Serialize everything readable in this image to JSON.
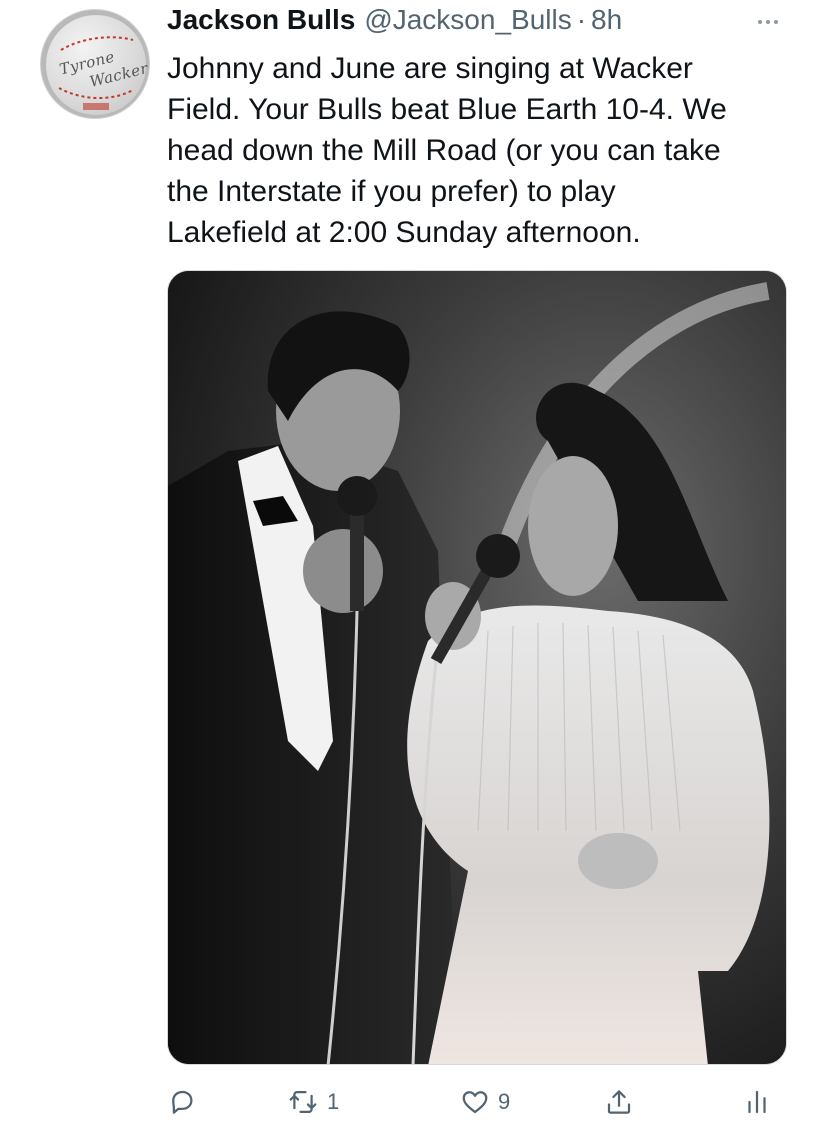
{
  "author": {
    "display_name": "Jackson Bulls",
    "handle": "@Jackson_Bulls",
    "separator": "·",
    "time": "8h",
    "avatar": {
      "line1": "Tyrone",
      "line2": "Wacker"
    }
  },
  "tweet": {
    "text": "Johnny and June are singing at Wacker\nField. Your Bulls beat Blue Earth 10-4. We\nhead down the Mill Road (or you can take\nthe Interstate if you prefer) to play\nLakefield at 2:00 Sunday afternoon."
  },
  "actions": {
    "reply_count": "",
    "retweet_count": "1",
    "like_count": "9",
    "icons": [
      "reply-icon",
      "retweet-icon",
      "like-icon",
      "share-icon",
      "analytics-icon"
    ]
  },
  "colors": {
    "text_primary": "#0f1419",
    "text_secondary": "#536471",
    "border": "#cfd9de"
  }
}
